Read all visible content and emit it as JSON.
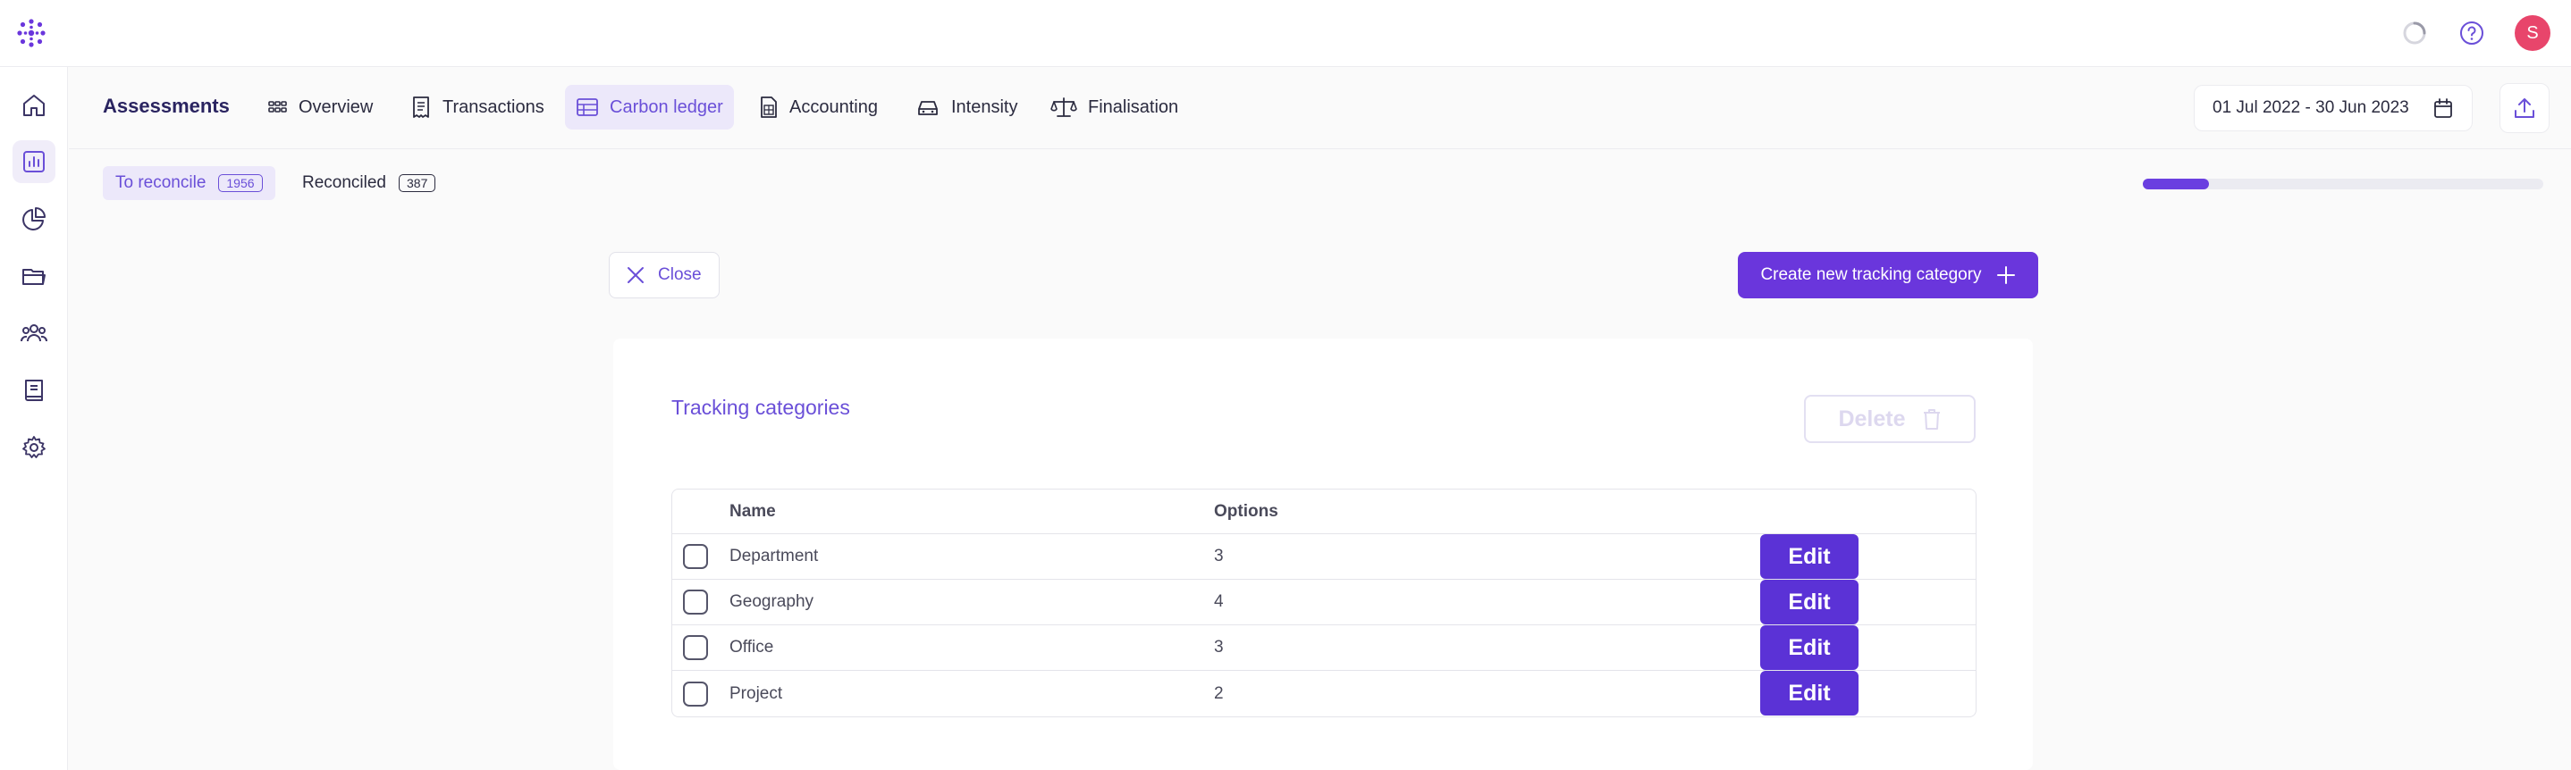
{
  "topbar": {
    "avatar_initial": "S",
    "icons": [
      "logo-icon",
      "loading-spinner-icon",
      "help-icon"
    ]
  },
  "sidebar": {
    "items": [
      {
        "name": "home",
        "icon": "home-icon",
        "active": false
      },
      {
        "name": "assessments",
        "icon": "bar-chart-icon",
        "active": true
      },
      {
        "name": "reports",
        "icon": "pie-chart-icon",
        "active": false
      },
      {
        "name": "files",
        "icon": "folder-icon",
        "active": false
      },
      {
        "name": "team",
        "icon": "users-icon",
        "active": false
      },
      {
        "name": "library",
        "icon": "book-icon",
        "active": false
      },
      {
        "name": "settings",
        "icon": "gear-icon",
        "active": false
      }
    ]
  },
  "subnav": {
    "title": "Assessments",
    "tabs": [
      {
        "label": "Overview",
        "icon": "grid-icon",
        "active": false
      },
      {
        "label": "Transactions",
        "icon": "receipt-icon",
        "active": false
      },
      {
        "label": "Carbon ledger",
        "icon": "table-icon",
        "active": true
      },
      {
        "label": "Accounting",
        "icon": "calculator-doc-icon",
        "active": false
      },
      {
        "label": "Intensity",
        "icon": "car-icon",
        "active": false
      },
      {
        "label": "Finalisation",
        "icon": "scales-icon",
        "active": false
      }
    ],
    "date_range": "01 Jul 2022 - 30 Jun 2023"
  },
  "filters": {
    "to_reconcile": {
      "label": "To reconcile",
      "count": "1956"
    },
    "reconciled": {
      "label": "Reconciled",
      "count": "387"
    },
    "progress_fraction": 0.165
  },
  "actions": {
    "close_label": "Close",
    "create_label": "Create new tracking category"
  },
  "panel": {
    "title": "Tracking categories",
    "delete_label": "Delete",
    "columns": [
      "Name",
      "Options"
    ],
    "rows": [
      {
        "name": "Department",
        "options": "3",
        "edit": "Edit"
      },
      {
        "name": "Geography",
        "options": "4",
        "edit": "Edit"
      },
      {
        "name": "Office",
        "options": "3",
        "edit": "Edit"
      },
      {
        "name": "Project",
        "options": "2",
        "edit": "Edit"
      }
    ]
  },
  "colors": {
    "accent": "#6a36dc",
    "accent_light": "#ece8fa",
    "avatar": "#e8456b"
  }
}
